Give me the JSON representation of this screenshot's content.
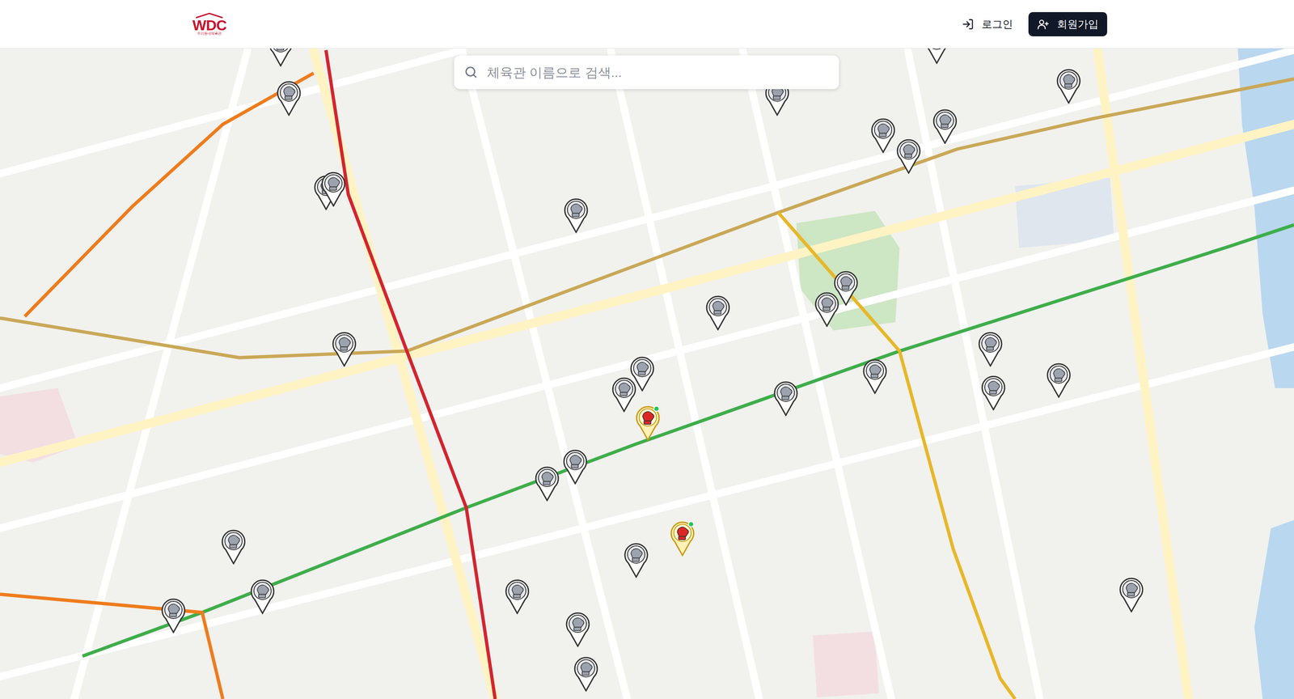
{
  "header": {
    "logo": "WDC",
    "logo_subtitle": "우리동네체육관",
    "login": "로그인",
    "signup": "회원가입"
  },
  "search": {
    "placeholder": "체육관 이름으로 검색..."
  },
  "map": {
    "pins": [
      {
        "kind": "gym"
      },
      {
        "kind": "gym"
      },
      {
        "kind": "gym"
      },
      {
        "kind": "gym"
      },
      {
        "kind": "gym"
      },
      {
        "kind": "gym"
      },
      {
        "kind": "gym"
      },
      {
        "kind": "gym"
      },
      {
        "kind": "gym"
      },
      {
        "kind": "gym"
      },
      {
        "kind": "gym"
      },
      {
        "kind": "gym"
      },
      {
        "kind": "gym"
      },
      {
        "kind": "gym"
      },
      {
        "kind": "gym"
      },
      {
        "kind": "gym"
      },
      {
        "kind": "gym"
      },
      {
        "kind": "highlight"
      },
      {
        "kind": "gym"
      },
      {
        "kind": "gym"
      },
      {
        "kind": "gym"
      },
      {
        "kind": "gym"
      },
      {
        "kind": "gym"
      },
      {
        "kind": "gym"
      },
      {
        "kind": "gym"
      },
      {
        "kind": "highlight"
      },
      {
        "kind": "gym"
      },
      {
        "kind": "gym"
      },
      {
        "kind": "gym"
      },
      {
        "kind": "gym"
      },
      {
        "kind": "gym"
      },
      {
        "kind": "gym"
      },
      {
        "kind": "gym"
      },
      {
        "kind": "gym"
      }
    ]
  }
}
